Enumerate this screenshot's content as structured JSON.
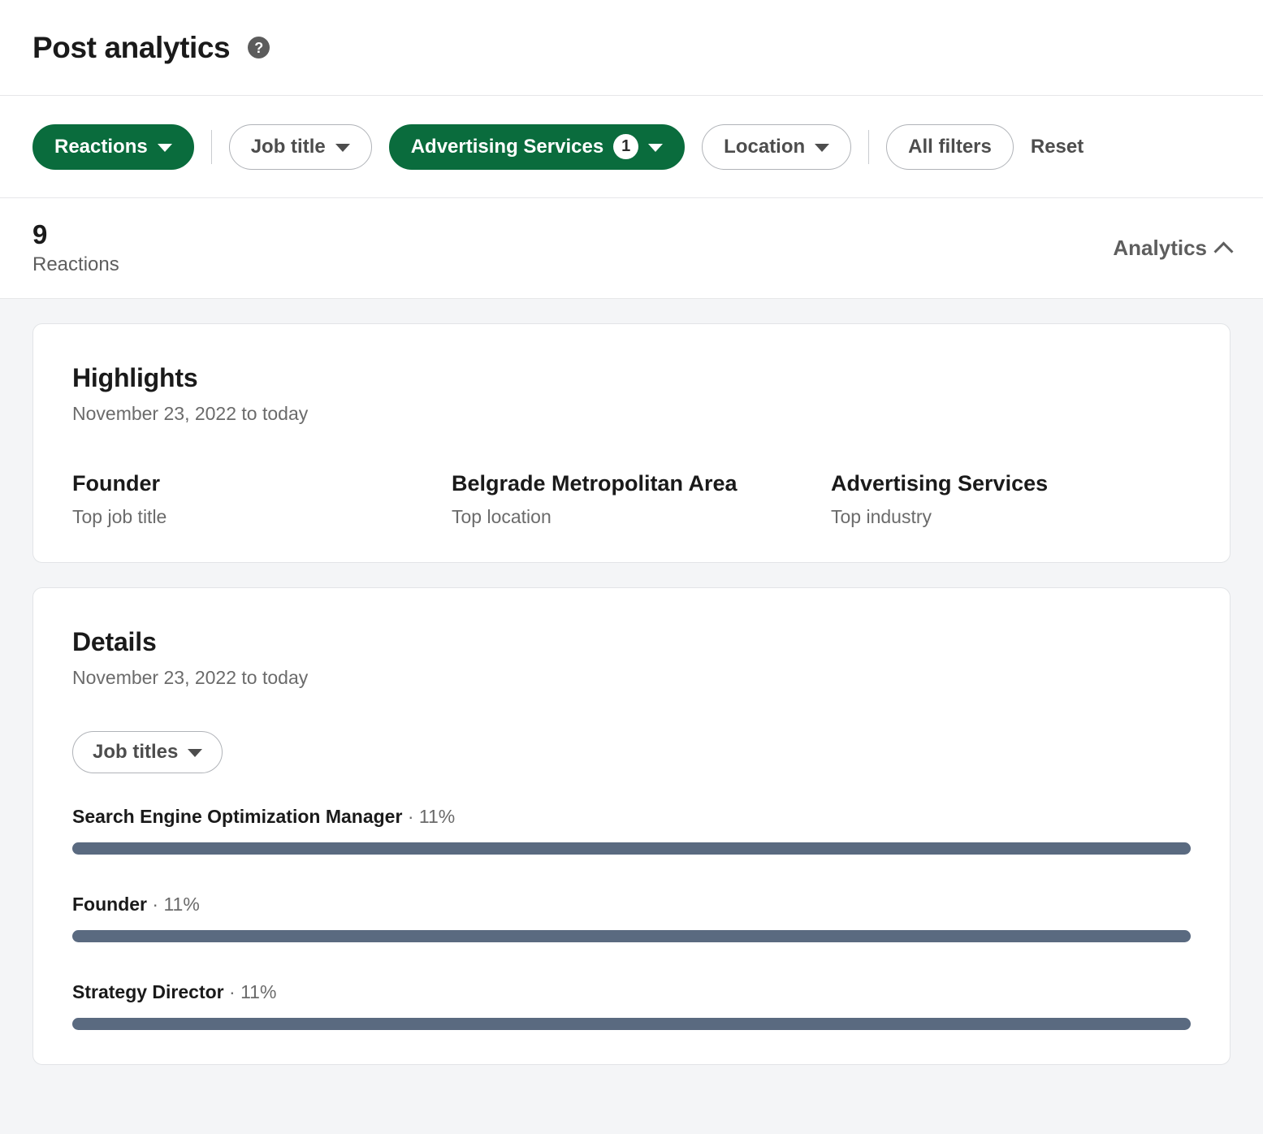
{
  "header": {
    "title": "Post analytics",
    "help_icon_glyph": "?"
  },
  "filters": {
    "reactions": {
      "label": "Reactions",
      "selected": true
    },
    "job_title": {
      "label": "Job title",
      "selected": false
    },
    "industry": {
      "label": "Advertising Services",
      "count": "1",
      "selected": true
    },
    "location": {
      "label": "Location",
      "selected": false
    },
    "all_filters": {
      "label": "All filters"
    },
    "reset": {
      "label": "Reset"
    }
  },
  "stats": {
    "value": "9",
    "label": "Reactions",
    "analytics_toggle": "Analytics"
  },
  "highlights": {
    "title": "Highlights",
    "date_range": "November 23, 2022 to today",
    "items": [
      {
        "value": "Founder",
        "label": "Top job title"
      },
      {
        "value": "Belgrade Metropolitan Area",
        "label": "Top location"
      },
      {
        "value": "Advertising Services",
        "label": "Top industry"
      }
    ]
  },
  "details": {
    "title": "Details",
    "date_range": "November 23, 2022 to today",
    "dimension_filter": "Job titles"
  },
  "chart_data": {
    "type": "bar",
    "title": "Details",
    "xlabel": "",
    "ylabel": "",
    "orientation": "horizontal",
    "categories": [
      "Search Engine Optimization Manager",
      "Founder",
      "Strategy Director"
    ],
    "values": [
      11,
      11,
      11
    ],
    "value_labels": [
      "11%",
      "11%",
      "11%"
    ],
    "separator": "·",
    "unit": "%",
    "xlim": [
      0,
      11
    ],
    "grid": false,
    "legend": null,
    "bar_color": "#5a6a80"
  },
  "colors": {
    "brand_green": "#0a6c3d",
    "bar": "#5a6a80",
    "page_bg": "#f4f5f7",
    "card_bg": "#ffffff",
    "text_primary": "#1a1a1a",
    "text_secondary": "#6b6b6b"
  }
}
